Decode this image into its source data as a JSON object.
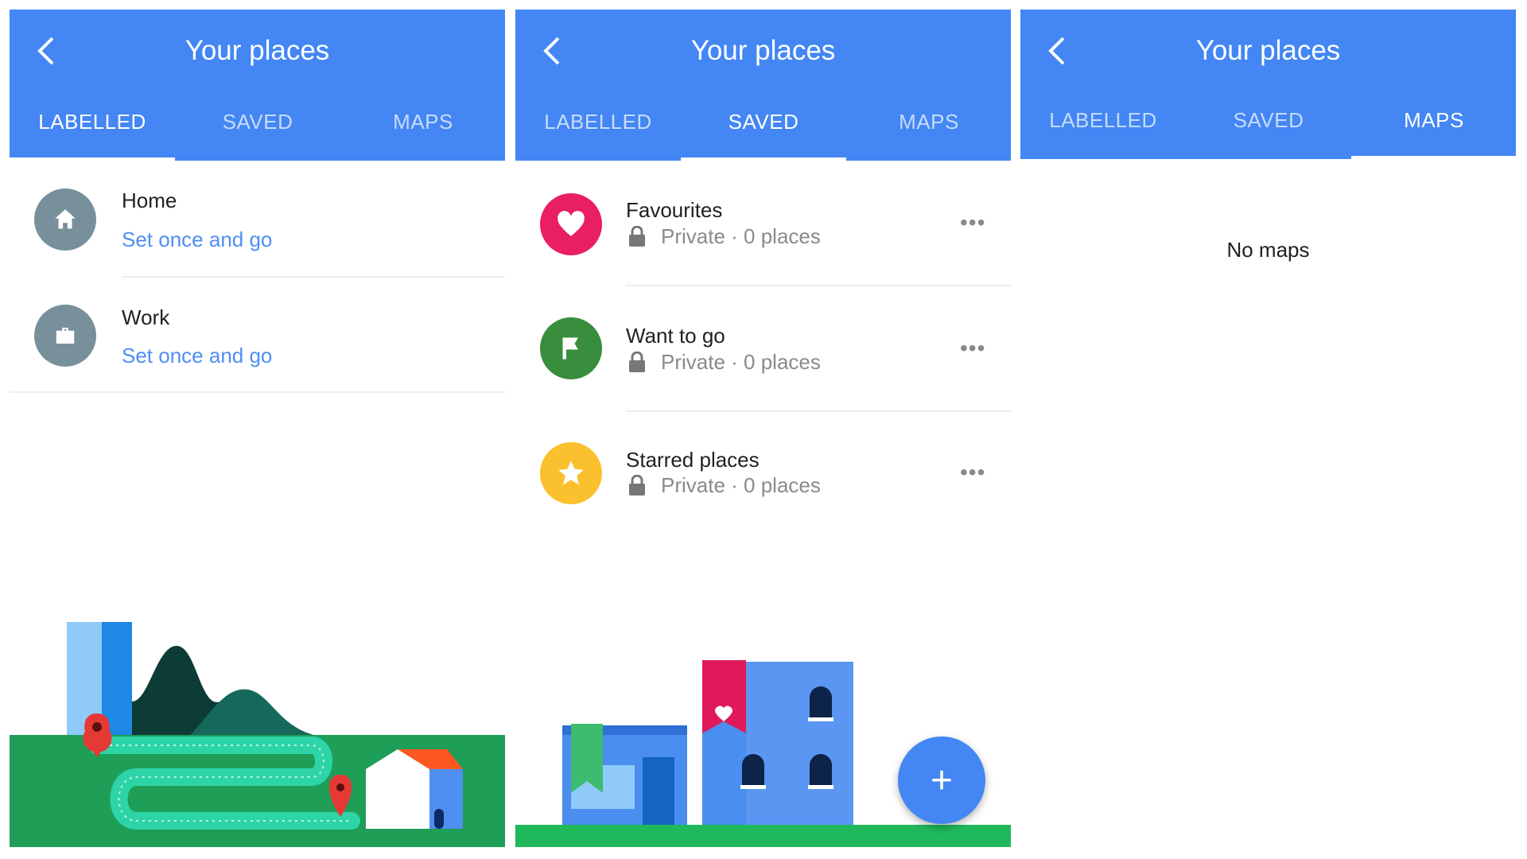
{
  "screens": [
    {
      "title": "Your places",
      "tabs": [
        "LABELLED",
        "SAVED",
        "MAPS"
      ],
      "active_tab": "LABELLED",
      "items": [
        {
          "label": "Home",
          "action": "Set once and go",
          "icon": "home-icon"
        },
        {
          "label": "Work",
          "action": "Set once and go",
          "icon": "briefcase-icon"
        }
      ]
    },
    {
      "title": "Your places",
      "tabs": [
        "LABELLED",
        "SAVED",
        "MAPS"
      ],
      "active_tab": "SAVED",
      "lists": [
        {
          "label": "Favourites",
          "meta": "Private · 0 places",
          "icon": "heart-icon",
          "color": "#e91e63"
        },
        {
          "label": "Want to go",
          "meta": "Private · 0 places",
          "icon": "flag-icon",
          "color": "#388e3c"
        },
        {
          "label": "Starred places",
          "meta": "Private · 0 places",
          "icon": "star-icon",
          "color": "#fbc02d"
        }
      ],
      "fab": "+"
    },
    {
      "title": "Your places",
      "tabs": [
        "LABELLED",
        "SAVED",
        "MAPS"
      ],
      "active_tab": "MAPS",
      "empty_text": "No maps"
    }
  ],
  "colors": {
    "header": "#4386f4",
    "link": "#4e8ef5",
    "avatar": "#78909c"
  }
}
